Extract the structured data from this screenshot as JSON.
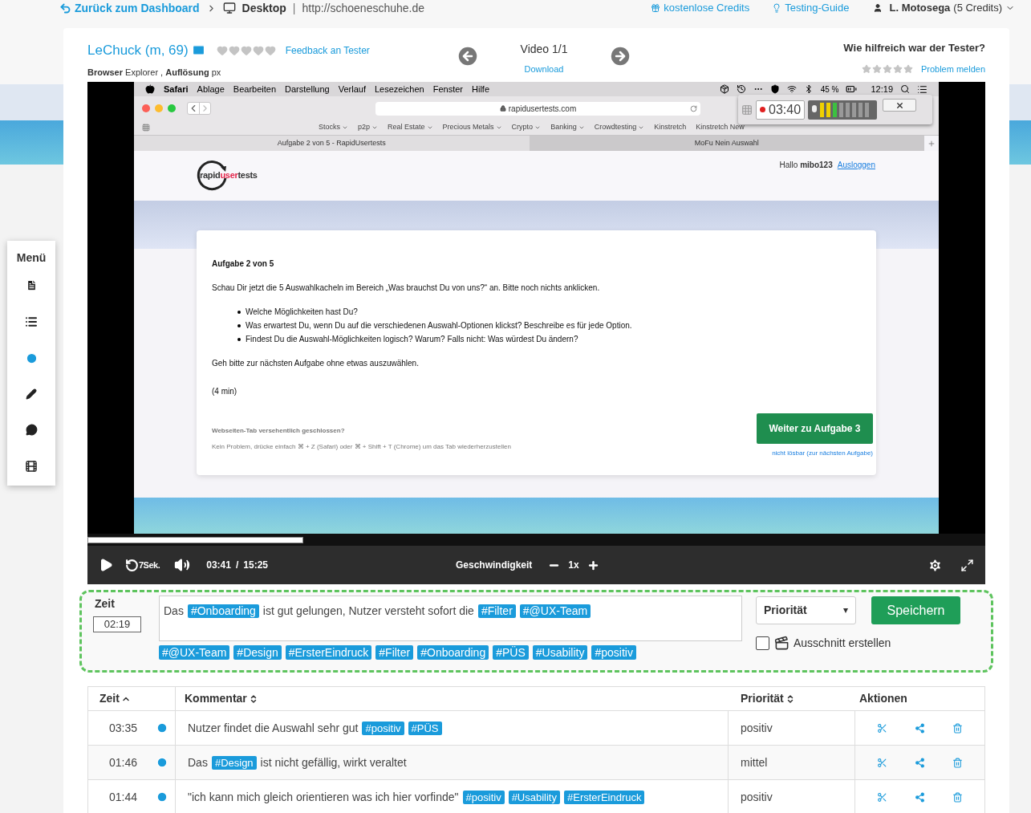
{
  "topbar": {
    "back": "Zurück zum Dashboard",
    "device": "Desktop",
    "url": "http://schoeneschuhe.de",
    "links": [
      "kostenlose Credits",
      "Testing-Guide"
    ],
    "separator": "|",
    "user": "L. Motosega",
    "credits": "(5 Credits)"
  },
  "header": {
    "tester": "LeChuck (m, 69)",
    "tester_rating": {
      "stars": 0
    },
    "feedback": "Feedback an Tester",
    "info": "**Browser** Explorer , **Auflösung** px",
    "video": "Video 1/1",
    "download": "Download",
    "rating_title": "Wie hilfreich war der Tester?",
    "stars": 0,
    "report": "Problem melden"
  },
  "menu": {
    "title": "Menü"
  },
  "video": {
    "menubar": {
      "app": "Safari",
      "items": [
        "Ablage",
        "Bearbeiten",
        "Darstellung",
        "Verlauf",
        "Lesezeichen",
        "Fenster",
        "Hilfe"
      ],
      "battery": "45 %",
      "clock": "12:19"
    },
    "address": "rapidusertests.com",
    "bookmarks": [
      {
        "label": "Stocks",
        "menu": true
      },
      {
        "label": "p2p",
        "menu": true
      },
      {
        "label": "Real Estate",
        "menu": true
      },
      {
        "label": "Precious Metals",
        "menu": true
      },
      {
        "label": "Crypto",
        "menu": true
      },
      {
        "label": "Banking",
        "menu": true
      },
      {
        "label": "Crowdtesting",
        "menu": true
      },
      {
        "label": "Kinstretch",
        "menu": false
      },
      {
        "label": "Kinstretch New",
        "menu": false
      }
    ],
    "tabs": [
      {
        "label": "Aufgabe 2 von 5 - RapidUsertests",
        "selected": true
      },
      {
        "label": "MoFu Nein Auswahl",
        "selected": false
      }
    ],
    "recorder": {
      "time": "03:40"
    },
    "site": {
      "logo": [
        "rapid",
        "user",
        "tests"
      ],
      "greeting": "Hallo **mibo123**",
      "logout": "Ausloggen",
      "task_title": "Aufgabe 2 von 5",
      "intro": "Schau Dir jetzt die 5 Auswahlkacheln im Bereich „Was brauchst Du von uns?“ an. Bitte noch nichts anklicken.",
      "bullets": [
        "Welche Möglichkeiten hast Du?",
        "Was erwartest Du, wenn Du auf die verschiedenen Auswahl-Optionen klickst? Beschreibe es für jede Option.",
        "Findest Du die Auswahl-Möglichkeiten logisch? Warum? Falls nicht: Was würdest Du ändern?"
      ],
      "note": "Geh bitte zur nächsten Aufgabe ohne etwas auszuwählen.",
      "duration": "(4 min)",
      "help_title": "Webseiten-Tab versehentlich geschlossen?",
      "help_text": "Kein Problem, drücke einfach ⌘ + Z (Safari) oder ⌘ + Shift + T (Chrome) um das Tab wiederherzustellen",
      "next": "Weiter zu Aufgabe 3",
      "skip": "nicht lösbar (zur nächsten Aufgabe)"
    },
    "progress": {
      "level": 0.24
    },
    "rewind": "7Sek.",
    "time": "03:41",
    "separator": "/",
    "duration": "15:25",
    "speed_label": "Geschwindigkeit",
    "speed": "1x"
  },
  "comment_form": {
    "time_label": "Zeit",
    "time": "02:19",
    "segments": [
      {
        "kind": "text",
        "text": "Das"
      },
      {
        "kind": "tag",
        "text": "#Onboarding"
      },
      {
        "kind": "text",
        "text": "ist gut gelungen, Nutzer versteht sofort die"
      },
      {
        "kind": "tag",
        "text": "#Filter"
      },
      {
        "kind": "tag",
        "text": "#@UX-Team"
      }
    ],
    "tags": [
      "#@UX-Team",
      "#Design",
      "#ErsterEindruck",
      "#Filter",
      "#Onboarding",
      "#PÜS",
      "#Usability",
      "#positiv"
    ],
    "priority": "Priorität",
    "save": "Speichern",
    "clip": {
      "label": "Ausschnitt erstellen",
      "checked": false
    }
  },
  "table": {
    "columns": [
      {
        "label": "Zeit",
        "sortable": true,
        "sorted": true
      },
      {
        "label": "Kommentar",
        "sortable": true,
        "sorted": false
      },
      {
        "label": "Priorität",
        "sortable": true,
        "sorted": false
      },
      {
        "label": "Aktionen",
        "sortable": false,
        "sorted": false
      }
    ],
    "rows": [
      {
        "time": "03:35",
        "segments": [
          {
            "kind": "text",
            "text": "Nutzer findet die Auswahl sehr gut"
          },
          {
            "kind": "tag",
            "text": "#positiv"
          },
          {
            "kind": "tag",
            "text": "#PÜS"
          }
        ],
        "priority": "positiv"
      },
      {
        "time": "01:46",
        "segments": [
          {
            "kind": "text",
            "text": "Das"
          },
          {
            "kind": "tag",
            "text": "#Design"
          },
          {
            "kind": "text",
            "text": "ist nicht gefällig, wirkt veraltet"
          }
        ],
        "priority": "mittel"
      },
      {
        "time": "01:44",
        "segments": [
          {
            "kind": "text",
            "text": "\"ich kann mich gleich orientieren was ich hier vorfinde\""
          },
          {
            "kind": "tag",
            "text": "#positiv"
          },
          {
            "kind": "tag",
            "text": "#Usability"
          },
          {
            "kind": "tag",
            "text": "#ErsterEindruck"
          }
        ],
        "priority": "positiv"
      }
    ]
  }
}
